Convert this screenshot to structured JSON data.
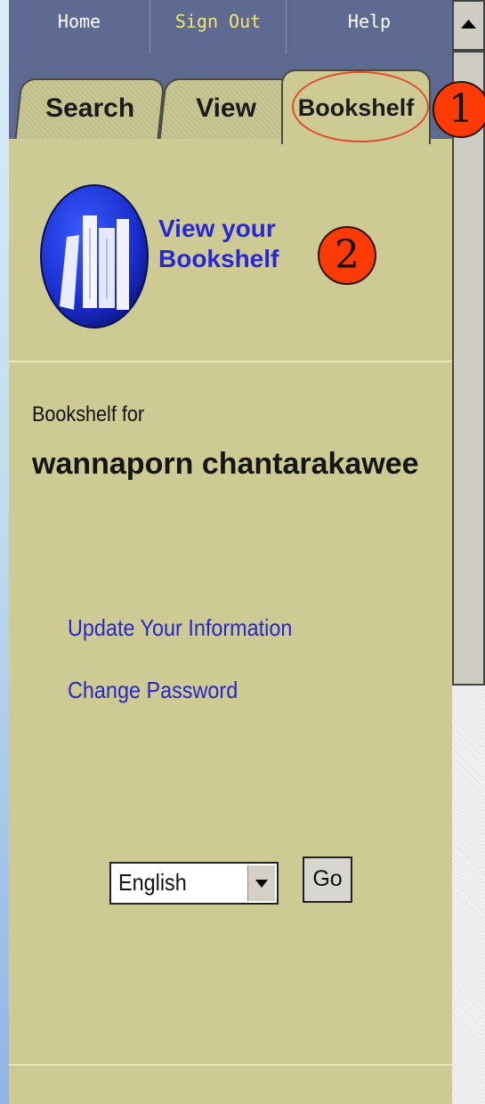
{
  "nav": {
    "home": "Home",
    "sign_out": "Sign Out",
    "help": "Help"
  },
  "tabs": [
    {
      "label": "Search"
    },
    {
      "label": "View"
    },
    {
      "label": "Bookshelf",
      "active": true
    }
  ],
  "callouts": {
    "badge_1": "1",
    "badge_2": "2"
  },
  "bookshelf_panel": {
    "view_link": "View your Bookshelf",
    "bookshelf_for": "Bookshelf for",
    "user_name": "wannaporn chantarakawee",
    "links": {
      "update_info": "Update Your Information",
      "change_password": "Change Password"
    }
  },
  "language": {
    "selected": "English",
    "go_label": "Go"
  },
  "colors": {
    "panel_bg": "#cdcb93",
    "nav_bg": "#5f6a93",
    "link_blue": "#2626c9",
    "sign_out_yellow": "#f5e66b",
    "callout_red": "#ff3b05"
  },
  "icons": [
    "book-shelf-icon",
    "dropdown-arrow-icon",
    "scroll-up-arrow-icon"
  ]
}
